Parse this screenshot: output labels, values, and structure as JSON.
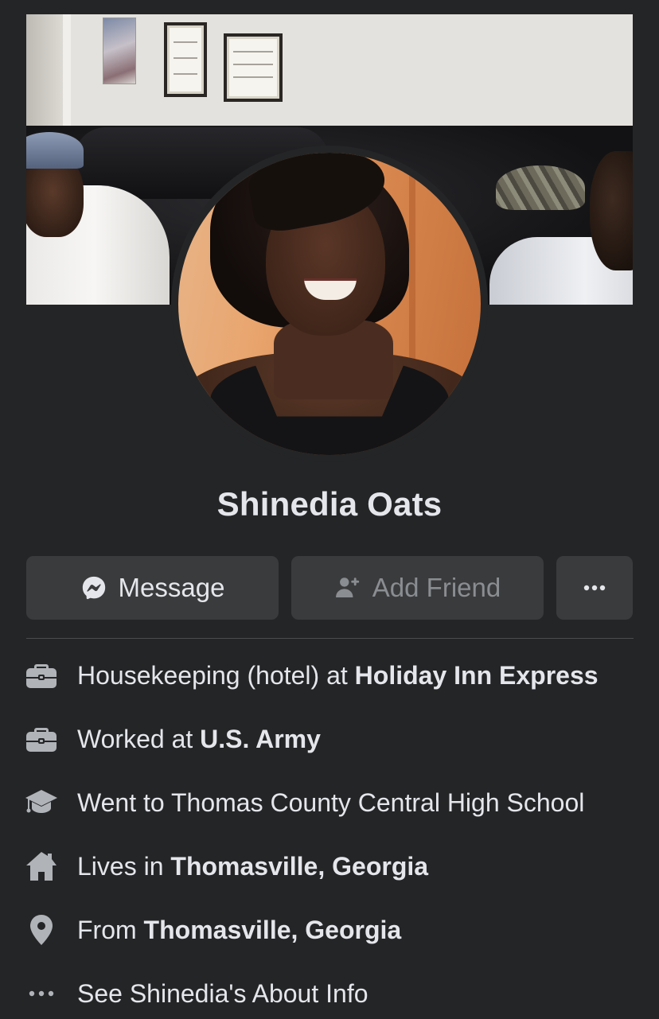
{
  "profile": {
    "name": "Shinedia Oats"
  },
  "actions": {
    "message_label": "Message",
    "add_friend_label": "Add Friend",
    "more_label": "•••"
  },
  "intro": {
    "work_current": {
      "prefix": "Housekeeping (hotel) at ",
      "place": "Holiday Inn Express",
      "icon": "briefcase-icon"
    },
    "work_past": {
      "prefix": "Worked at ",
      "place": "U.S. Army",
      "icon": "briefcase-icon"
    },
    "education": {
      "text": "Went to Thomas County Central High School",
      "icon": "graduation-cap-icon"
    },
    "lives": {
      "prefix": "Lives in ",
      "place": "Thomasville, Georgia",
      "icon": "home-icon"
    },
    "from": {
      "prefix": "From ",
      "place": "Thomasville, Georgia",
      "icon": "location-pin-icon"
    },
    "about": {
      "text": "See Shinedia's About Info",
      "icon": "more-dots-icon"
    }
  },
  "colors": {
    "background": "#242526",
    "button": "#3a3b3c",
    "text_primary": "#e4e6eb",
    "text_disabled": "#8a8d91",
    "icon": "#b0b3b8"
  }
}
